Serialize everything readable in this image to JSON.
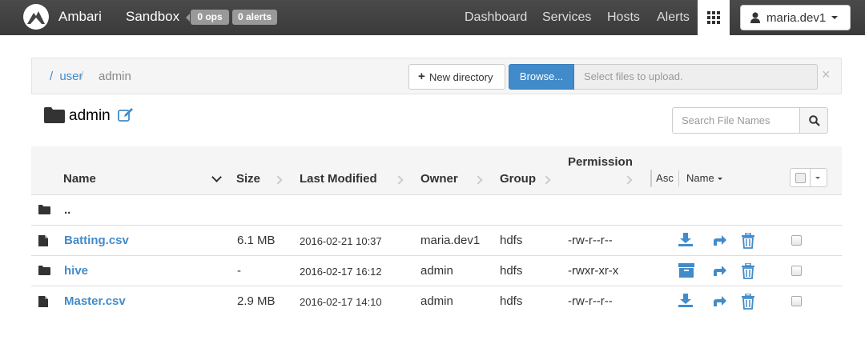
{
  "nav": {
    "brand": "Ambari",
    "cluster": "Sandbox",
    "ops_badge": "0 ops",
    "alerts_badge": "0 alerts",
    "links": [
      "Dashboard",
      "Services",
      "Hosts",
      "Alerts"
    ],
    "user": "maria.dev1"
  },
  "breadcrumb": {
    "items": [
      "/",
      "user",
      "/",
      "admin"
    ]
  },
  "toolbar": {
    "new_directory": "New directory",
    "browse": "Browse...",
    "upload_placeholder": "Select files to upload.",
    "close": "×"
  },
  "folder": {
    "title": "admin"
  },
  "search": {
    "placeholder": "Search File Names"
  },
  "table": {
    "headers": {
      "name": "Name",
      "size": "Size",
      "last_modified": "Last Modified",
      "owner": "Owner",
      "group": "Group",
      "permission": "Permission"
    },
    "sort_order": "Asc",
    "sort_by": "Name",
    "parent_row": "..",
    "rows": [
      {
        "name": "Batting.csv",
        "type": "file",
        "size": "6.1 MB",
        "modified": "2016-02-21 10:37",
        "owner": "maria.dev1",
        "group": "hdfs",
        "permission": "-rw-r--r--"
      },
      {
        "name": "hive",
        "type": "folder",
        "size": "-",
        "modified": "2016-02-17 16:12",
        "owner": "admin",
        "group": "hdfs",
        "permission": "-rwxr-xr-x"
      },
      {
        "name": "Master.csv",
        "type": "file",
        "size": "2.9 MB",
        "modified": "2016-02-17 14:10",
        "owner": "admin",
        "group": "hdfs",
        "permission": "-rw-r--r--"
      }
    ]
  },
  "colors": {
    "accent": "#428bca",
    "navbar": "#3f3f3f"
  }
}
